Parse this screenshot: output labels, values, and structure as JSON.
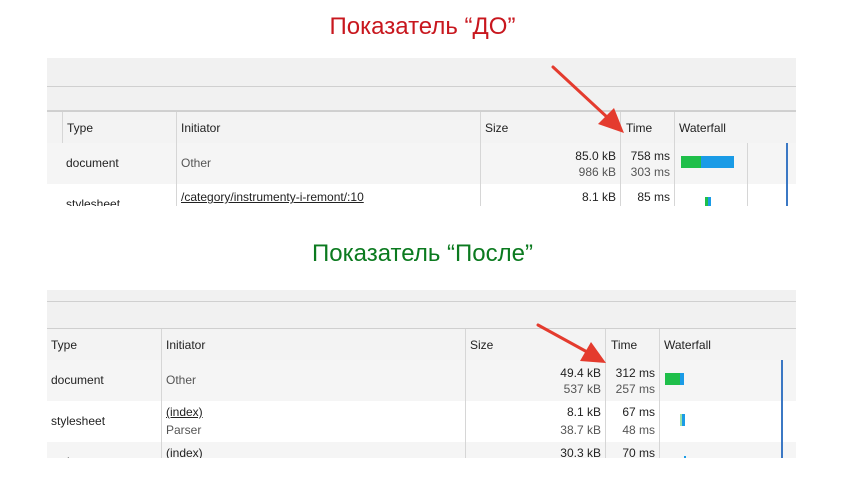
{
  "headings": {
    "before": "Показатель “ДО”",
    "after": "Показатель “После”"
  },
  "colors": {
    "before_heading": "#c8171e",
    "after_heading": "#0b7a1f",
    "arrow": "#e43b2e",
    "waterfall_green": "#1fbf4a",
    "waterfall_blue": "#1a9be6",
    "waterfall_line": "#3b78c4"
  },
  "columns": {
    "type": "Type",
    "initiator": "Initiator",
    "size": "Size",
    "time": "Time",
    "waterfall": "Waterfall"
  },
  "before_panel": {
    "rows": [
      {
        "type": "document",
        "initiator": "Other",
        "initiator_sub": "",
        "size": "85.0 kB",
        "size_sub": "986 kB",
        "time": "758 ms",
        "time_sub": "303 ms"
      },
      {
        "type": "stylesheet",
        "initiator": "/category/instrumenty-i-remont/:10",
        "initiator_sub": "",
        "size": "8.1 kB",
        "size_sub": "",
        "time": "85 ms",
        "time_sub": ""
      }
    ]
  },
  "after_panel": {
    "rows": [
      {
        "type": "document",
        "initiator": "Other",
        "initiator_sub": "",
        "size": "49.4 kB",
        "size_sub": "537 kB",
        "time": "312 ms",
        "time_sub": "257 ms"
      },
      {
        "type": "stylesheet",
        "initiator": "(index)",
        "initiator_sub": "Parser",
        "size": "8.1 kB",
        "size_sub": "38.7 kB",
        "time": "67 ms",
        "time_sub": "48 ms"
      },
      {
        "type": "script",
        "initiator": "(index)",
        "initiator_sub": "",
        "size": "30.3 kB",
        "size_sub": "",
        "time": "70 ms",
        "time_sub": ""
      }
    ]
  }
}
